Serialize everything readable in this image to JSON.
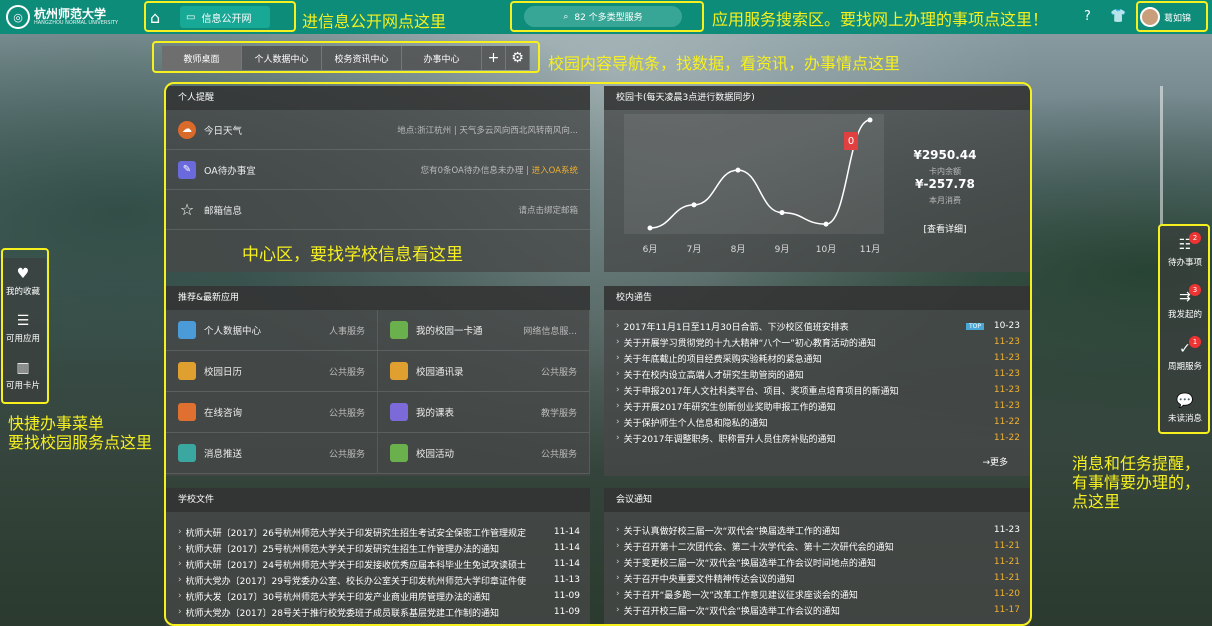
{
  "header": {
    "logo_text": "杭州师范大学",
    "logo_en": "HANGZHOU NORMAL UNIVERSITY",
    "info_button": "信息公开网",
    "search_placeholder": "82 个多类型服务",
    "user_name": "葛如锦"
  },
  "annotations": {
    "info": "进信息公开网点这里",
    "search": "应用服务搜索区。要找网上办理的事项点这里！",
    "nav": "校园内容导航条，找数据，看资讯，办事情点这里",
    "center": "中心区，要找学校信息看这里",
    "quick": "快捷办事菜单\n要找校园服务点这里",
    "messages": "消息和任务提醒，有事情要办理的，点这里"
  },
  "nav": {
    "tabs": [
      "教师桌面",
      "个人数据中心",
      "校务资讯中心",
      "办事中心"
    ]
  },
  "reminder": {
    "title": "个人提醒",
    "rows": [
      {
        "label": "今日天气",
        "loc": "地点:浙江杭州",
        "sep": "|",
        "info": "天气多云风向西北风转南风向..."
      },
      {
        "label": "OA待办事宜",
        "info": "您有0条OA待办信息未办理",
        "sep": "|",
        "link": "进入OA系统"
      },
      {
        "label": "邮箱信息",
        "link": "请点击绑定邮箱"
      }
    ]
  },
  "card": {
    "title": "校园卡(每天凌晨3点进行数据同步)",
    "months": [
      "6月",
      "7月",
      "8月",
      "9月",
      "10月",
      "11月"
    ],
    "badge": "0",
    "balance": "¥2950.44",
    "balance_label": "卡内余额",
    "spend": "¥-257.78",
    "spend_label": "本月消费",
    "detail": "[查看详细]"
  },
  "chart_data": {
    "type": "line",
    "categories": [
      "6月",
      "7月",
      "8月",
      "9月",
      "10月",
      "11月"
    ],
    "values": [
      0,
      30,
      75,
      20,
      5,
      140
    ]
  },
  "apps": {
    "title": "推荐&最新应用",
    "items": [
      {
        "name": "个人数据中心",
        "cat": "人事服务"
      },
      {
        "name": "我的校园一卡通",
        "cat": "网络信息服..."
      },
      {
        "name": "校园日历",
        "cat": "公共服务"
      },
      {
        "name": "校园通讯录",
        "cat": "公共服务"
      },
      {
        "name": "在线咨询",
        "cat": "公共服务"
      },
      {
        "name": "我的课表",
        "cat": "教学服务"
      },
      {
        "name": "消息推送",
        "cat": "公共服务"
      },
      {
        "name": "校园活动",
        "cat": "公共服务"
      }
    ]
  },
  "notices": {
    "title": "校内通告",
    "items": [
      {
        "t": "2017年11月1日至11月30日合箭、下沙校区值班安排表",
        "d": "10-23",
        "top": "TOP"
      },
      {
        "t": "关于开展学习贯彻党的十九大精神“八个一”初心教育活动的通知",
        "d": "11-23"
      },
      {
        "t": "关于年底截止的项目经费采购实验耗材的紧急通知",
        "d": "11-23"
      },
      {
        "t": "关于在校内设立高端人才研究生助管岗的通知",
        "d": "11-23"
      },
      {
        "t": "关于申报2017年人文社科类平台、项目、奖项重点培育项目的新通知",
        "d": "11-23"
      },
      {
        "t": "关于开展2017年研究生创新创业奖助申报工作的通知",
        "d": "11-23"
      },
      {
        "t": "关于保护师生个人信息和隐私的通知",
        "d": "11-22"
      },
      {
        "t": "关于2017年调整职务、职称晋升人员住房补贴的通知",
        "d": "11-22"
      }
    ],
    "more": "→更多"
  },
  "docs": {
    "title": "学校文件",
    "items": [
      {
        "t": "杭师大研〔2017〕26号杭州师范大学关于印发研究生招生考试安全保密工作管理规定",
        "d": "11-14"
      },
      {
        "t": "杭师大研〔2017〕25号杭州师范大学关于印发研究生招生工作管理办法的通知",
        "d": "11-14"
      },
      {
        "t": "杭师大研〔2017〕24号杭州师范大学关于印发接收优秀应届本科毕业生免试攻读硕士",
        "d": "11-14"
      },
      {
        "t": "杭师大党办〔2017〕29号党委办公室、校长办公室关于印发杭州师范大学印章证件使",
        "d": "11-13"
      },
      {
        "t": "杭师大发〔2017〕30号杭州师范大学关于印发产业商业用房管理办法的通知",
        "d": "11-09"
      },
      {
        "t": "杭师大党办〔2017〕28号关于推行校党委班子成员联系基层党建工作制的通知",
        "d": "11-09"
      }
    ]
  },
  "meetings": {
    "title": "会议通知",
    "items": [
      {
        "t": "关于认真做好校三届一次“双代会”换届选举工作的通知",
        "d": "11-23"
      },
      {
        "t": "关于召开第十二次团代会、第二十次学代会、第十二次研代会的通知",
        "d": "11-21"
      },
      {
        "t": "关于变更校三届一次“双代会”换届选举工作会议时间地点的通知",
        "d": "11-21"
      },
      {
        "t": "关于召开中央重要文件精神传达会议的通知",
        "d": "11-21"
      },
      {
        "t": "关于召开“最多跑一次”改革工作意见建议征求座谈会的通知",
        "d": "11-20"
      },
      {
        "t": "关于召开校三届一次“双代会”换届选举工作会议的通知",
        "d": "11-17"
      }
    ]
  },
  "quick": {
    "items": [
      "我的收藏",
      "可用应用",
      "可用卡片"
    ]
  },
  "side": {
    "items": [
      {
        "label": "待办事项",
        "count": "2"
      },
      {
        "label": "我发起的",
        "count": "3"
      },
      {
        "label": "周期服务",
        "count": "1"
      },
      {
        "label": "未读消息",
        "count": ""
      }
    ]
  }
}
